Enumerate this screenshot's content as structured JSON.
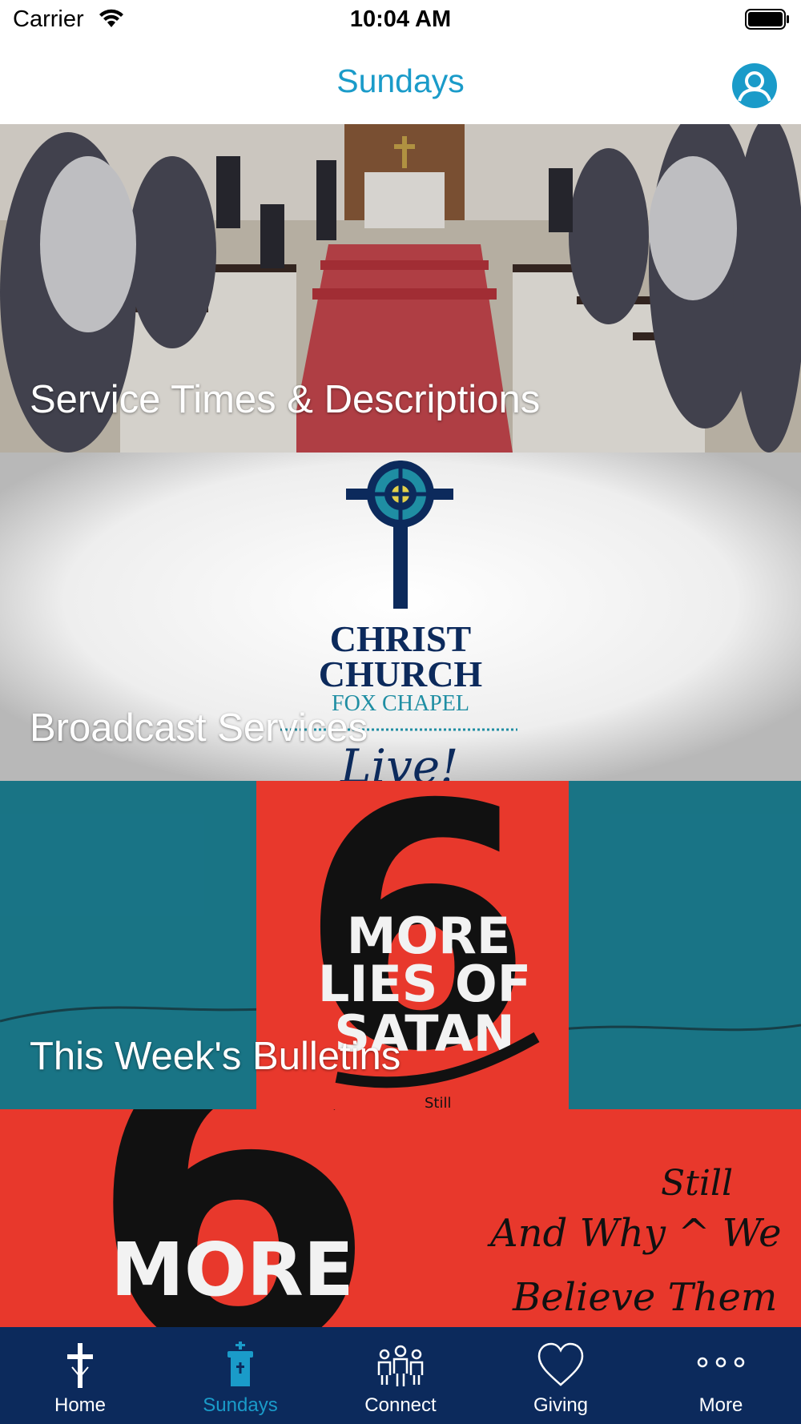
{
  "status_bar": {
    "carrier": "Carrier",
    "time": "10:04 AM"
  },
  "nav": {
    "title": "Sundays",
    "profile_icon": "user-icon"
  },
  "tiles": [
    {
      "label": "Service Times & Descriptions"
    },
    {
      "label": "Broadcast Services",
      "logo_line1": "CHRIST",
      "logo_line2": "CHURCH",
      "logo_line3": "FOX CHAPEL",
      "logo_script": "Live!"
    },
    {
      "label": "This Week's Bulletins",
      "art_lines": [
        "MORE",
        "LIES OF",
        "SATAN"
      ],
      "art_number": "6",
      "art_note": "Still"
    },
    {
      "art_number": "6",
      "art_word": "MORE",
      "art_script_1": "Still",
      "art_script_2": "And Why ^ We",
      "art_script_3": "Believe  Them"
    }
  ],
  "tabs": [
    {
      "label": "Home",
      "icon": "cross-icon",
      "active": false
    },
    {
      "label": "Sundays",
      "icon": "pulpit-icon",
      "active": true
    },
    {
      "label": "Connect",
      "icon": "people-icon",
      "active": false
    },
    {
      "label": "Giving",
      "icon": "heart-icon",
      "active": false
    },
    {
      "label": "More",
      "icon": "ellipsis-icon",
      "active": false
    }
  ],
  "colors": {
    "accent": "#1a9bc9",
    "tab_bar": "#0c2a5c",
    "bulletin_red": "#e8382c",
    "bulletin_teal": "#1f8ea3"
  }
}
